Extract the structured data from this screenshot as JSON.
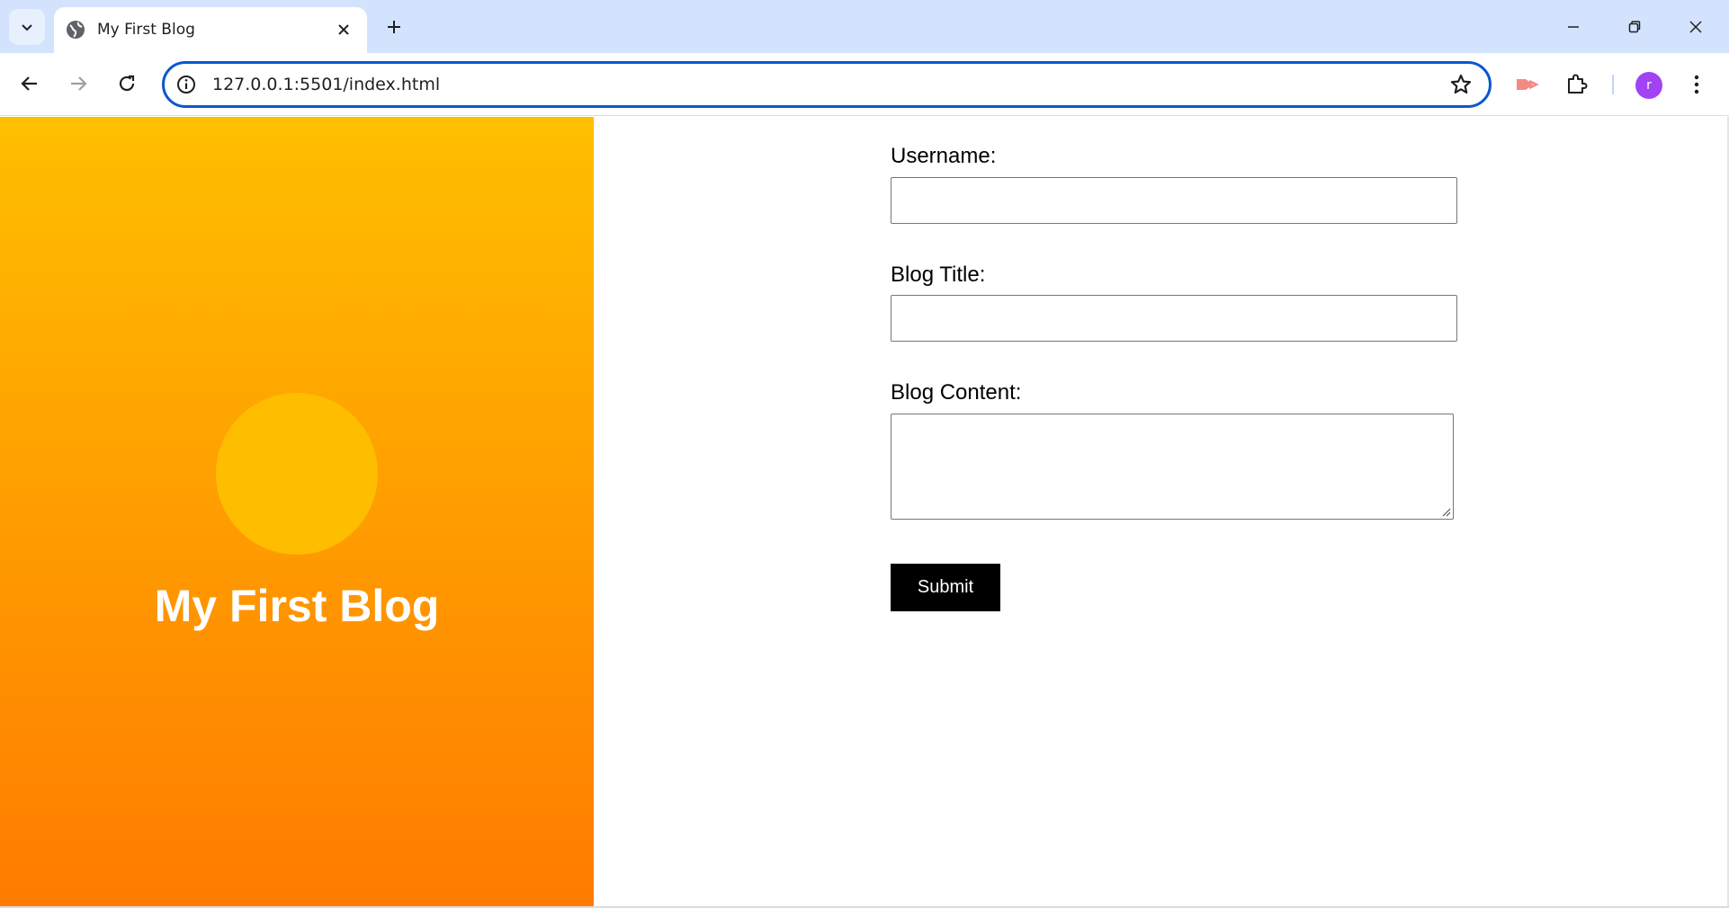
{
  "browser": {
    "tab_title": "My First Blog",
    "url": "127.0.0.1:5501/index.html",
    "avatar_initial": "r",
    "accent_color": "#0b57d0",
    "icons": [
      "tab-search-icon",
      "globe-icon",
      "close-icon",
      "plus-icon",
      "minimize-icon",
      "restore-icon",
      "close-window-icon",
      "back-icon",
      "forward-icon",
      "reload-icon",
      "site-info-icon",
      "star-icon",
      "extension-puzzle-icon",
      "more-vert-icon"
    ]
  },
  "hero": {
    "title": "My First Blog",
    "gradient_top": "#ffbf00",
    "gradient_bottom": "#ff7b00",
    "circle_color": "#ffbd00"
  },
  "form": {
    "username_label": "Username:",
    "username_value": "",
    "title_label": "Blog Title:",
    "title_value": "",
    "content_label": "Blog Content:",
    "content_value": "",
    "submit_label": "Submit"
  }
}
